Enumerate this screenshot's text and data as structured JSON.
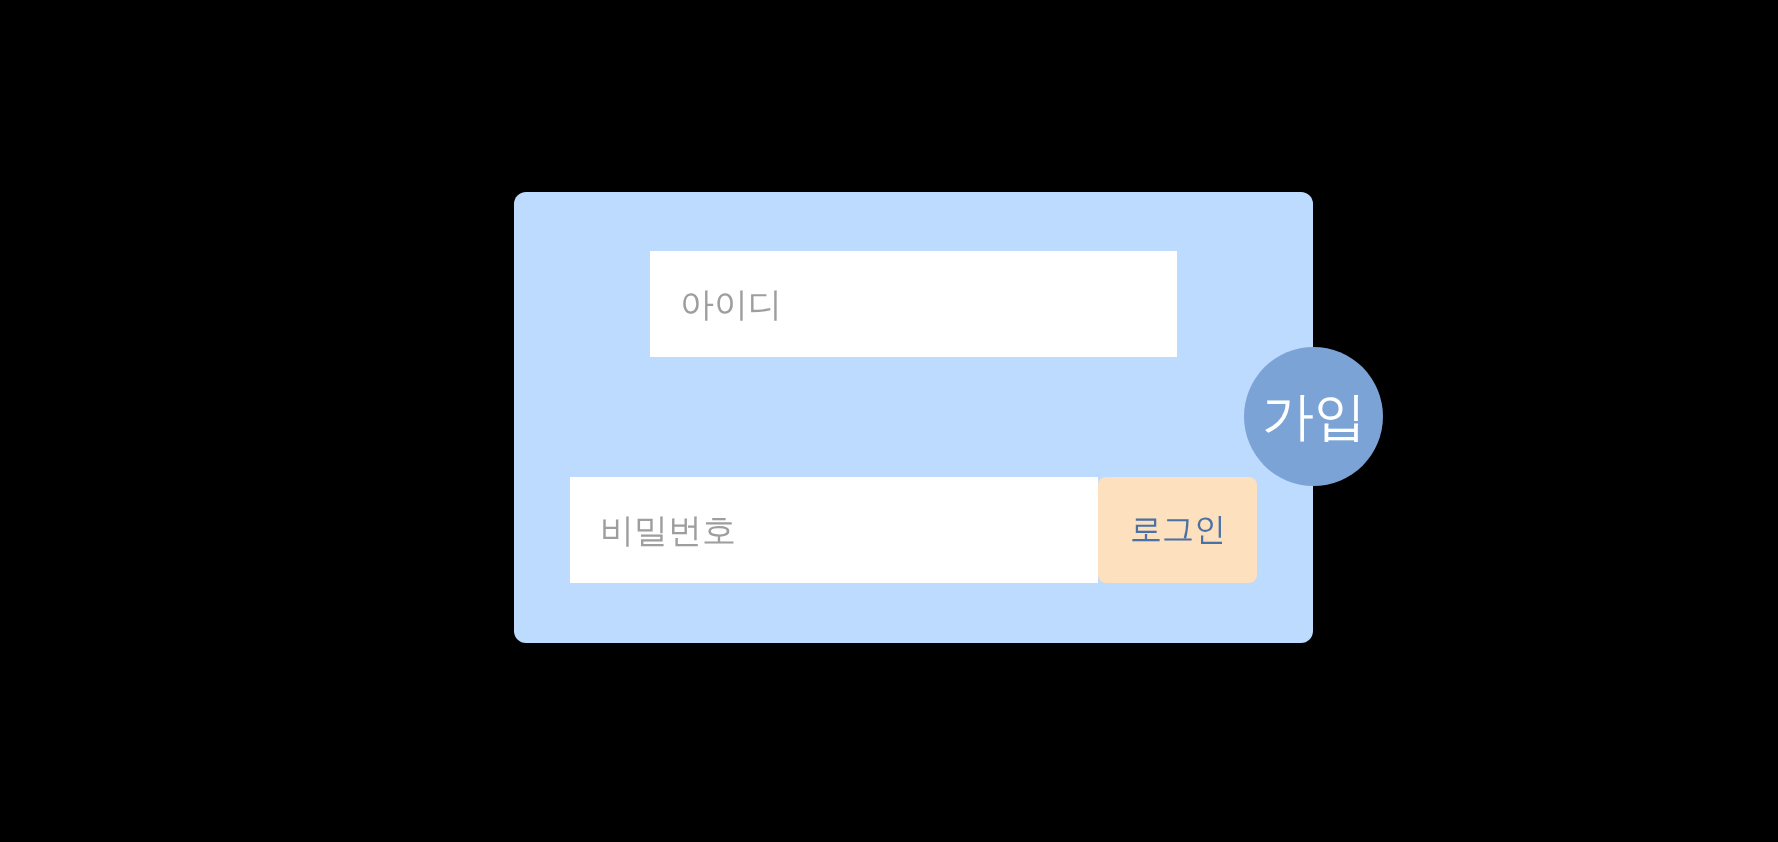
{
  "login_card": {
    "id_field": {
      "placeholder": "아이디"
    },
    "password_field": {
      "placeholder": "비밀번호"
    },
    "login_button": {
      "label": "로그인"
    },
    "join_button": {
      "label": "가입"
    }
  }
}
